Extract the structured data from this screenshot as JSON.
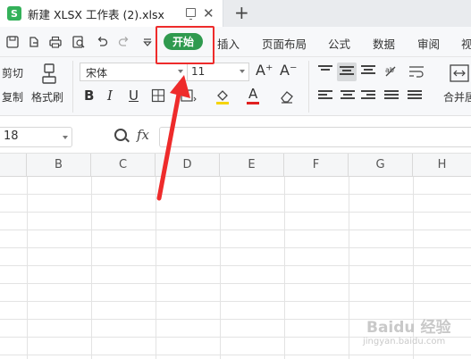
{
  "tab": {
    "logo": "S",
    "title": "新建 XLSX 工作表 (2).xlsx",
    "close": "✕",
    "new_tab": "+"
  },
  "menu": {
    "active": "开始",
    "items": [
      "插入",
      "页面布局",
      "公式",
      "数据",
      "审阅",
      "视"
    ]
  },
  "ribbon": {
    "cut": "剪切",
    "copy": "复制",
    "format_painter": "格式刷",
    "font_name": "宋体",
    "font_size": "11",
    "bold": "B",
    "italic": "I",
    "underline": "U",
    "font_color_letter": "A",
    "grow": "A⁺",
    "shrink": "A⁻",
    "merge": "合并居",
    "font_color": "#e02020",
    "fill_color": "#f5d400"
  },
  "formula": {
    "name_box": "18",
    "fx": "fx",
    "value": ""
  },
  "grid": {
    "columns": [
      "B",
      "C",
      "D",
      "E",
      "F",
      "G",
      "H"
    ]
  },
  "annotation": {
    "box_color": "#ee2b2b"
  },
  "watermark": {
    "main": "Baidu 经验",
    "sub": "jingyan.baidu.com"
  }
}
